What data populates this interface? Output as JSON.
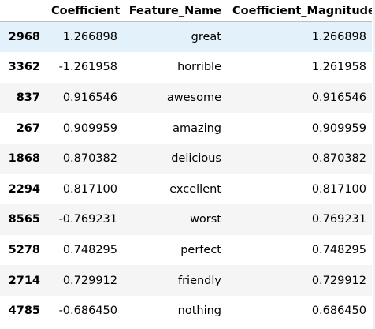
{
  "table": {
    "columns": [
      "",
      "Coefficient",
      "Feature_Name",
      "Coefficient_Magnitude"
    ],
    "rows": [
      {
        "index": "2968",
        "coefficient": "1.266898",
        "feature": "great",
        "magnitude": "1.266898"
      },
      {
        "index": "3362",
        "coefficient": "-1.261958",
        "feature": "horrible",
        "magnitude": "1.261958"
      },
      {
        "index": "837",
        "coefficient": "0.916546",
        "feature": "awesome",
        "magnitude": "0.916546"
      },
      {
        "index": "267",
        "coefficient": "0.909959",
        "feature": "amazing",
        "magnitude": "0.909959"
      },
      {
        "index": "1868",
        "coefficient": "0.870382",
        "feature": "delicious",
        "magnitude": "0.870382"
      },
      {
        "index": "2294",
        "coefficient": "0.817100",
        "feature": "excellent",
        "magnitude": "0.817100"
      },
      {
        "index": "8565",
        "coefficient": "-0.769231",
        "feature": "worst",
        "magnitude": "0.769231"
      },
      {
        "index": "5278",
        "coefficient": "0.748295",
        "feature": "perfect",
        "magnitude": "0.748295"
      },
      {
        "index": "2714",
        "coefficient": "0.729912",
        "feature": "friendly",
        "magnitude": "0.729912"
      },
      {
        "index": "4785",
        "coefficient": "-0.686450",
        "feature": "nothing",
        "magnitude": "0.686450"
      }
    ]
  },
  "colors": {
    "hover_row": "#e3f1fb",
    "stripe_row": "#f5f5f5",
    "header_border": "#bdbdbd"
  }
}
